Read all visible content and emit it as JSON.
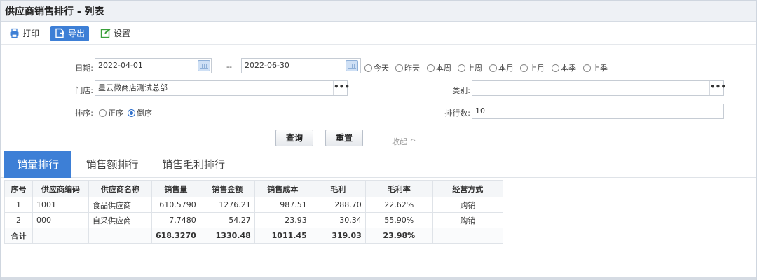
{
  "title": "供应商销售排行 - 列表",
  "toolbar": {
    "print_label": "打印",
    "export_label": "导出",
    "settings_label": "设置"
  },
  "form": {
    "date_label": "日期:",
    "date_from": "2022-04-01",
    "date_sep": "--",
    "date_to": "2022-06-30",
    "quick_ranges": [
      "今天",
      "昨天",
      "本周",
      "上周",
      "本月",
      "上月",
      "本季",
      "上季"
    ],
    "store_label": "门店:",
    "store_value": "星云微商店测试总部",
    "category_label": "类别:",
    "category_value": "",
    "sort_label": "排序:",
    "sort_options": [
      "正序",
      "倒序"
    ],
    "sort_selected": "倒序",
    "rank_count_label": "排行数:",
    "rank_count_value": "10",
    "ellipsis": "•••"
  },
  "actions": {
    "query_label": "查询",
    "reset_label": "重置",
    "collapse_label": "收起 ^"
  },
  "tabs": [
    {
      "label": "销量排行",
      "active": true
    },
    {
      "label": "销售额排行",
      "active": false
    },
    {
      "label": "销售毛利排行",
      "active": false
    }
  ],
  "table": {
    "columns": [
      "序号",
      "供应商编码",
      "供应商名称",
      "销售量",
      "销售金额",
      "销售成本",
      "毛利",
      "毛利率",
      "经营方式"
    ],
    "rows": [
      [
        "1",
        "1001",
        "食品供应商",
        "610.5790",
        "1276.21",
        "987.51",
        "288.70",
        "22.62%",
        "购销"
      ],
      [
        "2",
        "000",
        "自采供应商",
        "7.7480",
        "54.27",
        "23.93",
        "30.34",
        "55.90%",
        "购销"
      ]
    ],
    "total": [
      "合计",
      "",
      "",
      "618.3270",
      "1330.48",
      "1011.45",
      "319.03",
      "23.98%",
      ""
    ]
  },
  "colors": {
    "accent": "#3d7fd6",
    "header_bg": "#eef1f5"
  }
}
